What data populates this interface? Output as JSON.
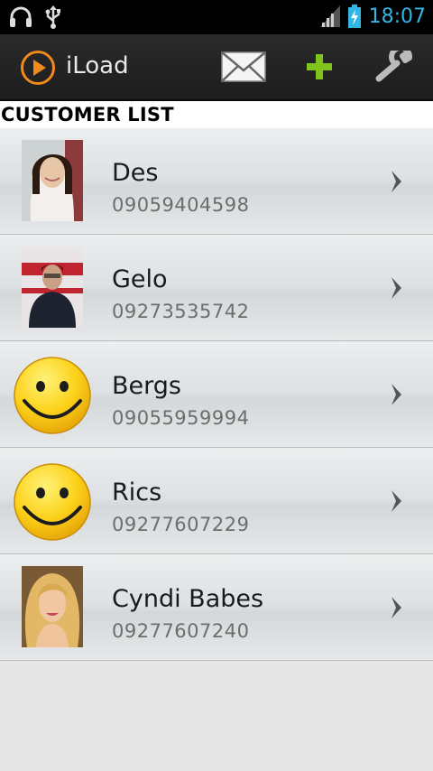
{
  "status_bar": {
    "time": "18:07",
    "icons": [
      "headphones-icon",
      "usb-icon",
      "signal-icon",
      "battery-charging-icon"
    ]
  },
  "action_bar": {
    "title": "iLoad",
    "actions": [
      "mail-icon",
      "add-icon",
      "wrench-icon"
    ]
  },
  "section": {
    "title": "CUSTOMER LIST"
  },
  "customers": [
    {
      "name": "Des",
      "phone": "09059404598",
      "avatar": "photo"
    },
    {
      "name": "Gelo",
      "phone": "09273535742",
      "avatar": "photo"
    },
    {
      "name": "Bergs",
      "phone": "09055959994",
      "avatar": "smiley"
    },
    {
      "name": "Rics",
      "phone": "09277607229",
      "avatar": "smiley"
    },
    {
      "name": "Cyndi Babes",
      "phone": "09277607240",
      "avatar": "photo"
    }
  ],
  "colors": {
    "accent": "#33b5e5",
    "logo": "#f08a1c",
    "add": "#7fc31c"
  }
}
